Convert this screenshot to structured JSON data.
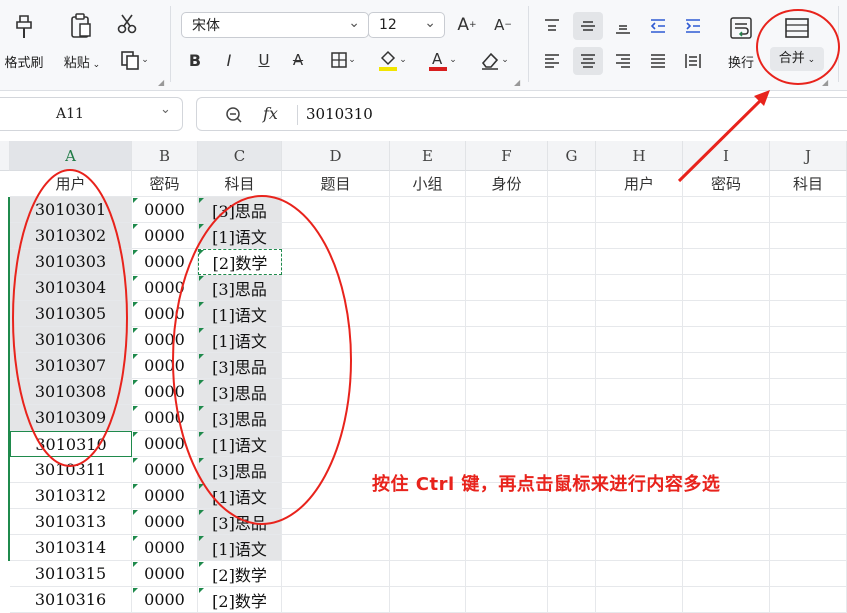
{
  "ribbon": {
    "format_painter": "格式刷",
    "paste": "粘贴",
    "font_name": "宋体",
    "font_size": "12",
    "wrap": "换行",
    "merge": "合并"
  },
  "formula": {
    "cell_ref": "A11",
    "fx_label": "fx",
    "value": "3010310"
  },
  "columns": [
    "A",
    "B",
    "C",
    "D",
    "E",
    "F",
    "G",
    "H",
    "I",
    "J"
  ],
  "headers": [
    "用户",
    "密码",
    "科目",
    "题目",
    "小组",
    "身份",
    "",
    "用户",
    "密码",
    "科目"
  ],
  "rows": [
    {
      "user": "3010301",
      "pwd": "0000",
      "subject": "[3]思品"
    },
    {
      "user": "3010302",
      "pwd": "0000",
      "subject": "[1]语文"
    },
    {
      "user": "3010303",
      "pwd": "0000",
      "subject": "[2]数学"
    },
    {
      "user": "3010304",
      "pwd": "0000",
      "subject": "[3]思品"
    },
    {
      "user": "3010305",
      "pwd": "0000",
      "subject": "[1]语文"
    },
    {
      "user": "3010306",
      "pwd": "0000",
      "subject": "[1]语文"
    },
    {
      "user": "3010307",
      "pwd": "0000",
      "subject": "[3]思品"
    },
    {
      "user": "3010308",
      "pwd": "0000",
      "subject": "[3]思品"
    },
    {
      "user": "3010309",
      "pwd": "0000",
      "subject": "[3]思品"
    },
    {
      "user": "3010310",
      "pwd": "0000",
      "subject": "[1]语文"
    },
    {
      "user": "3010311",
      "pwd": "0000",
      "subject": "[3]思品"
    },
    {
      "user": "3010312",
      "pwd": "0000",
      "subject": "[1]语文"
    },
    {
      "user": "3010313",
      "pwd": "0000",
      "subject": "[3]思品"
    },
    {
      "user": "3010314",
      "pwd": "0000",
      "subject": "[1]语文"
    },
    {
      "user": "3010315",
      "pwd": "0000",
      "subject": "[2]数学"
    },
    {
      "user": "3010316",
      "pwd": "0000",
      "subject": "[2]数学"
    }
  ],
  "annotation": "按住 Ctrl 键，再点击鼠标来进行内容多选",
  "colors": {
    "annotation_red": "#e8231c",
    "selection_green": "#1f8a4c",
    "highlight_gray": "#e4e5e7"
  }
}
